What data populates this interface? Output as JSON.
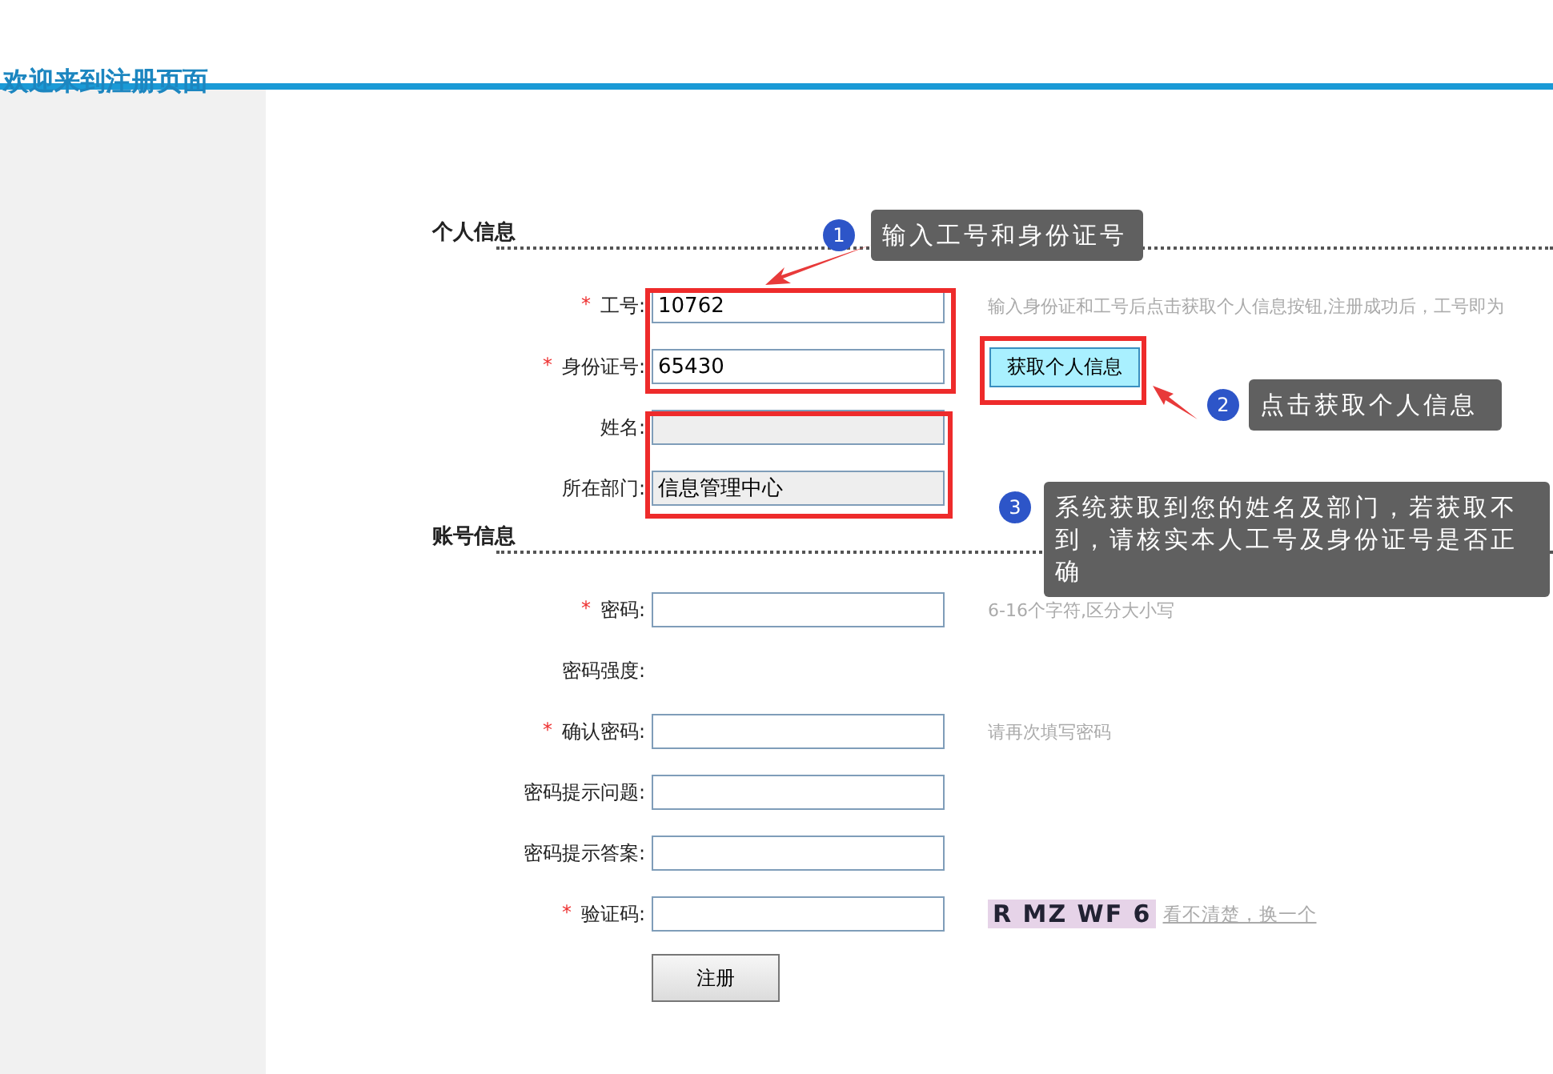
{
  "page_title": "欢迎来到注册页面",
  "required_mark": "*",
  "sections": [
    {
      "title": "个人信息",
      "rows": [
        {
          "kind": "input",
          "label": "工号:",
          "required": true,
          "value": "10762",
          "readonly": false,
          "hint": "输入身份证和工号后点击获取个人信息按钮,注册成功后，工号即为"
        },
        {
          "kind": "input",
          "label": "身份证号:",
          "required": true,
          "value": "65430",
          "readonly": false,
          "button": "获取个人信息"
        },
        {
          "kind": "input",
          "label": "姓名:",
          "required": false,
          "readonly": true
        },
        {
          "kind": "input",
          "label": "所在部门:",
          "required": false,
          "value": "信息管理中心",
          "readonly": true
        }
      ]
    },
    {
      "title": "账号信息",
      "rows": [
        {
          "kind": "input",
          "label": "密码:",
          "required": true,
          "readonly": false,
          "hint": "6-16个字符,区分大小写"
        },
        {
          "kind": "text",
          "label": "密码强度:",
          "required": false
        },
        {
          "kind": "input",
          "label": "确认密码:",
          "required": true,
          "readonly": false,
          "hint": "请再次填写密码"
        },
        {
          "kind": "input",
          "label": "密码提示问题:",
          "required": false,
          "readonly": false
        },
        {
          "kind": "input",
          "label": "密码提示答案:",
          "required": false,
          "readonly": false
        },
        {
          "kind": "captcha",
          "label": "验证码:",
          "required": true,
          "readonly": false,
          "captcha": "R MZ WF 6",
          "link": "看不清楚，换一个"
        }
      ]
    }
  ],
  "submit": "注册",
  "callouts": [
    {
      "number": "1",
      "text": "输入工号和身份证号"
    },
    {
      "number": "2",
      "text": "点击获取个人信息"
    },
    {
      "number": "3",
      "text": "系统获取到您的姓名及部门，若获取不到，请核实本人工号及身份证号是否正确"
    }
  ]
}
